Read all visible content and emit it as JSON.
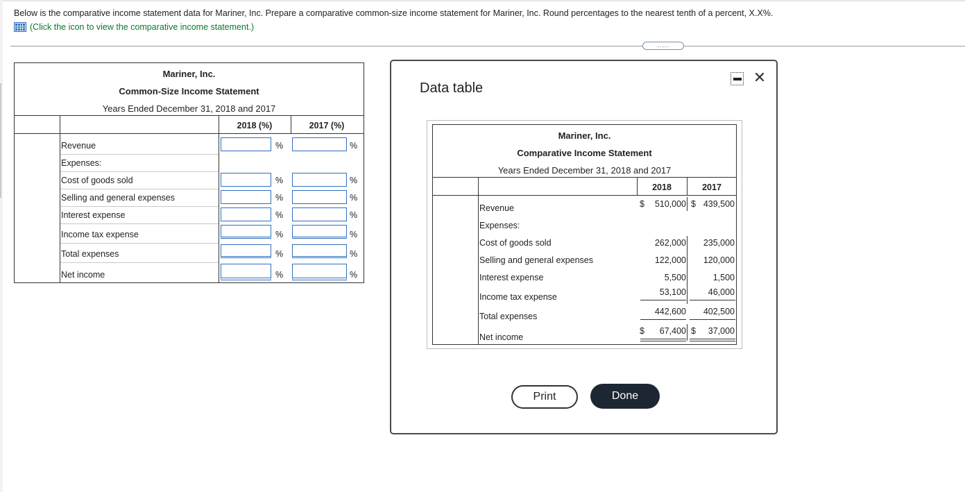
{
  "instructions": "Below is the comparative income statement data for Mariner, Inc. Prepare a comparative common-size income statement for Mariner, Inc. Round percentages to the nearest tenth of a percent, X.X%.",
  "click_link": "(Click the icon to view the comparative income statement.)",
  "more_indicator": ".....",
  "common_size": {
    "company": "Mariner, Inc.",
    "title": "Common-Size Income Statement",
    "period": "Years Ended December 31, 2018 and 2017",
    "col_2018": "2018 (%)",
    "col_2017": "2017 (%)",
    "pct_symbol": "%",
    "rows": [
      {
        "label": "Revenue",
        "input_2018": "",
        "input_2017": ""
      },
      {
        "label": "Expenses:"
      },
      {
        "label": "Cost of goods sold",
        "input_2018": "",
        "input_2017": ""
      },
      {
        "label": "Selling and general expenses",
        "input_2018": "",
        "input_2017": ""
      },
      {
        "label": "Interest expense",
        "input_2018": "",
        "input_2017": ""
      },
      {
        "label": "Income tax expense",
        "input_2018": "",
        "input_2017": ""
      },
      {
        "label": "Total expenses",
        "input_2018": "",
        "input_2017": ""
      },
      {
        "label": "Net income",
        "input_2018": "",
        "input_2017": ""
      }
    ]
  },
  "modal": {
    "title": "Data table",
    "company": "Mariner, Inc.",
    "statement_title": "Comparative Income Statement",
    "period": "Years Ended December 31, 2018 and 2017",
    "col_2018": "2018",
    "col_2017": "2017",
    "currency": "$",
    "rows": [
      {
        "label": "Revenue",
        "v2018": "510,000",
        "v2017": "439,500"
      },
      {
        "label": "Expenses:",
        "v2018": "",
        "v2017": ""
      },
      {
        "label": "Cost of goods sold",
        "v2018": "262,000",
        "v2017": "235,000"
      },
      {
        "label": "Selling and general expenses",
        "v2018": "122,000",
        "v2017": "120,000"
      },
      {
        "label": "Interest expense",
        "v2018": "5,500",
        "v2017": "1,500"
      },
      {
        "label": "Income tax expense",
        "v2018": "53,100",
        "v2017": "46,000"
      },
      {
        "label": "Total expenses",
        "v2018": "442,600",
        "v2017": "402,500"
      },
      {
        "label": "Net income",
        "v2018": "67,400",
        "v2017": "37,000"
      }
    ],
    "print_label": "Print",
    "done_label": "Done"
  },
  "colors": {
    "link_green": "#0a7a2a",
    "input_border": "#2e6fbf",
    "done_bg": "#1d2733"
  }
}
